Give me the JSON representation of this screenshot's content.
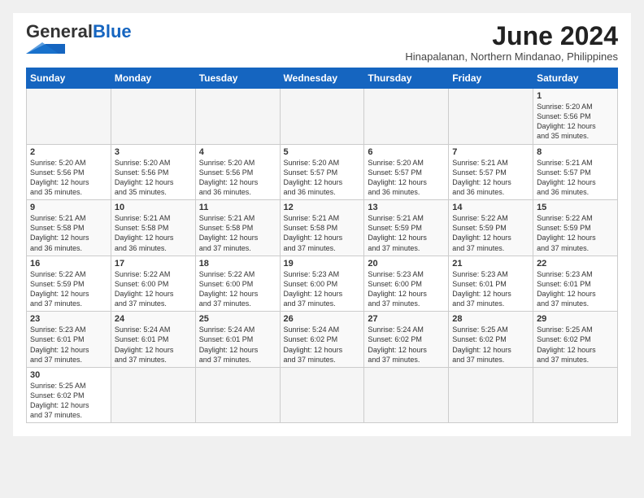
{
  "header": {
    "logo_general": "General",
    "logo_blue": "Blue",
    "month_title": "June 2024",
    "subtitle": "Hinapalanan, Northern Mindanao, Philippines"
  },
  "weekdays": [
    "Sunday",
    "Monday",
    "Tuesday",
    "Wednesday",
    "Thursday",
    "Friday",
    "Saturday"
  ],
  "weeks": [
    [
      {
        "day": "",
        "info": ""
      },
      {
        "day": "",
        "info": ""
      },
      {
        "day": "",
        "info": ""
      },
      {
        "day": "",
        "info": ""
      },
      {
        "day": "",
        "info": ""
      },
      {
        "day": "",
        "info": ""
      },
      {
        "day": "1",
        "info": "Sunrise: 5:20 AM\nSunset: 5:56 PM\nDaylight: 12 hours\nand 35 minutes."
      }
    ],
    [
      {
        "day": "2",
        "info": "Sunrise: 5:20 AM\nSunset: 5:56 PM\nDaylight: 12 hours\nand 35 minutes."
      },
      {
        "day": "3",
        "info": "Sunrise: 5:20 AM\nSunset: 5:56 PM\nDaylight: 12 hours\nand 35 minutes."
      },
      {
        "day": "4",
        "info": "Sunrise: 5:20 AM\nSunset: 5:56 PM\nDaylight: 12 hours\nand 36 minutes."
      },
      {
        "day": "5",
        "info": "Sunrise: 5:20 AM\nSunset: 5:57 PM\nDaylight: 12 hours\nand 36 minutes."
      },
      {
        "day": "6",
        "info": "Sunrise: 5:20 AM\nSunset: 5:57 PM\nDaylight: 12 hours\nand 36 minutes."
      },
      {
        "day": "7",
        "info": "Sunrise: 5:21 AM\nSunset: 5:57 PM\nDaylight: 12 hours\nand 36 minutes."
      },
      {
        "day": "8",
        "info": "Sunrise: 5:21 AM\nSunset: 5:57 PM\nDaylight: 12 hours\nand 36 minutes."
      }
    ],
    [
      {
        "day": "9",
        "info": "Sunrise: 5:21 AM\nSunset: 5:58 PM\nDaylight: 12 hours\nand 36 minutes."
      },
      {
        "day": "10",
        "info": "Sunrise: 5:21 AM\nSunset: 5:58 PM\nDaylight: 12 hours\nand 36 minutes."
      },
      {
        "day": "11",
        "info": "Sunrise: 5:21 AM\nSunset: 5:58 PM\nDaylight: 12 hours\nand 37 minutes."
      },
      {
        "day": "12",
        "info": "Sunrise: 5:21 AM\nSunset: 5:58 PM\nDaylight: 12 hours\nand 37 minutes."
      },
      {
        "day": "13",
        "info": "Sunrise: 5:21 AM\nSunset: 5:59 PM\nDaylight: 12 hours\nand 37 minutes."
      },
      {
        "day": "14",
        "info": "Sunrise: 5:22 AM\nSunset: 5:59 PM\nDaylight: 12 hours\nand 37 minutes."
      },
      {
        "day": "15",
        "info": "Sunrise: 5:22 AM\nSunset: 5:59 PM\nDaylight: 12 hours\nand 37 minutes."
      }
    ],
    [
      {
        "day": "16",
        "info": "Sunrise: 5:22 AM\nSunset: 5:59 PM\nDaylight: 12 hours\nand 37 minutes."
      },
      {
        "day": "17",
        "info": "Sunrise: 5:22 AM\nSunset: 6:00 PM\nDaylight: 12 hours\nand 37 minutes."
      },
      {
        "day": "18",
        "info": "Sunrise: 5:22 AM\nSunset: 6:00 PM\nDaylight: 12 hours\nand 37 minutes."
      },
      {
        "day": "19",
        "info": "Sunrise: 5:23 AM\nSunset: 6:00 PM\nDaylight: 12 hours\nand 37 minutes."
      },
      {
        "day": "20",
        "info": "Sunrise: 5:23 AM\nSunset: 6:00 PM\nDaylight: 12 hours\nand 37 minutes."
      },
      {
        "day": "21",
        "info": "Sunrise: 5:23 AM\nSunset: 6:01 PM\nDaylight: 12 hours\nand 37 minutes."
      },
      {
        "day": "22",
        "info": "Sunrise: 5:23 AM\nSunset: 6:01 PM\nDaylight: 12 hours\nand 37 minutes."
      }
    ],
    [
      {
        "day": "23",
        "info": "Sunrise: 5:23 AM\nSunset: 6:01 PM\nDaylight: 12 hours\nand 37 minutes."
      },
      {
        "day": "24",
        "info": "Sunrise: 5:24 AM\nSunset: 6:01 PM\nDaylight: 12 hours\nand 37 minutes."
      },
      {
        "day": "25",
        "info": "Sunrise: 5:24 AM\nSunset: 6:01 PM\nDaylight: 12 hours\nand 37 minutes."
      },
      {
        "day": "26",
        "info": "Sunrise: 5:24 AM\nSunset: 6:02 PM\nDaylight: 12 hours\nand 37 minutes."
      },
      {
        "day": "27",
        "info": "Sunrise: 5:24 AM\nSunset: 6:02 PM\nDaylight: 12 hours\nand 37 minutes."
      },
      {
        "day": "28",
        "info": "Sunrise: 5:25 AM\nSunset: 6:02 PM\nDaylight: 12 hours\nand 37 minutes."
      },
      {
        "day": "29",
        "info": "Sunrise: 5:25 AM\nSunset: 6:02 PM\nDaylight: 12 hours\nand 37 minutes."
      }
    ],
    [
      {
        "day": "30",
        "info": "Sunrise: 5:25 AM\nSunset: 6:02 PM\nDaylight: 12 hours\nand 37 minutes."
      },
      {
        "day": "",
        "info": ""
      },
      {
        "day": "",
        "info": ""
      },
      {
        "day": "",
        "info": ""
      },
      {
        "day": "",
        "info": ""
      },
      {
        "day": "",
        "info": ""
      },
      {
        "day": "",
        "info": ""
      }
    ]
  ]
}
